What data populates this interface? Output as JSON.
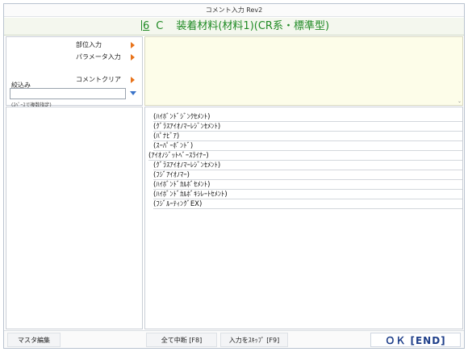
{
  "window": {
    "title": "コメント入力 Rev2"
  },
  "heading": {
    "code": "6",
    "letter": "C",
    "title": "装着材料(材料1)(CR系・標準型)"
  },
  "left_panel": {
    "menu": [
      {
        "label": "部位入力"
      },
      {
        "label": "パラメータ入力"
      },
      {
        "label": "コメントクリア"
      }
    ],
    "filter_label": "絞込み",
    "filter_value": "",
    "filter_hint": "(ｽﾍﾟｰｽで複数指定)"
  },
  "preview": {
    "text": "",
    "scroll_indicator": "⌄"
  },
  "comment_list": [
    "(ﾊｲﾎﾞﾝﾄﾞｼﾞﾝｸｾﾒﾝﾄ)",
    "(ｸﾞﾗｽｱｲｵﾉﾏｰﾚｼﾞﾝｾﾒﾝﾄ)",
    "(ﾊﾟﾅﾋﾞｱ)",
    "(ｽｰﾊﾟｰﾎﾞﾝﾄﾞ)",
    "(ｱｲｵﾉｼﾞｯﾄﾍﾞｰｽﾗｲﾅｰ)",
    "(ｸﾞﾗｽｱｲｵﾉﾏｰﾚｼﾞﾝｾﾒﾝﾄ)",
    "(ﾌｼﾞｱｲｵﾉﾏｰ)",
    "(ﾊｲﾎﾞﾝﾄﾞｶﾙﾎﾞｾﾒﾝﾄ)",
    "(ﾊｲﾎﾞﾝﾄﾞｶﾙﾎﾞｷｼﾚｰﾄｾﾒﾝﾄ)",
    "(ﾌｼﾞﾙｰﾃｨﾝｸﾞEX)"
  ],
  "buttons": {
    "master_edit": "マスタ編集",
    "cancel_all": "全て中断 [F8]",
    "skip_input": "入力をｽｷｯﾌﾟ [F9]",
    "ok": "ＯＫ [END]"
  },
  "colors": {
    "heading_text": "#1f8a24",
    "menu_arrow": "#e8731a",
    "ok_text": "#1f3f8a",
    "preview_bg": "#fdfde9"
  }
}
